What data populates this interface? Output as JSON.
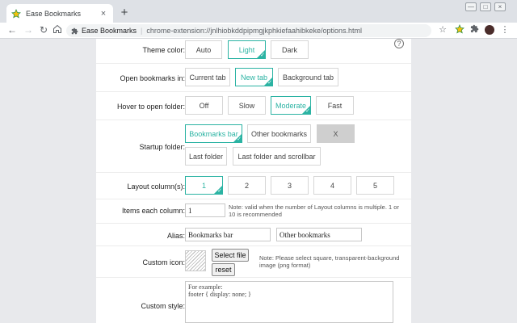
{
  "browser": {
    "tab_title": "Ease Bookmarks",
    "tab_close": "×",
    "new_tab": "+",
    "window_controls": [
      "—",
      "□",
      "×"
    ],
    "address_ext_name": "Ease Bookmarks",
    "address_separator": "|",
    "address_url": "chrome-extension://jnlhiobkddpipmgjkphkiefaahibkeke/options.html"
  },
  "help": "?",
  "theme": {
    "label": "Theme color:",
    "options": [
      "Auto",
      "Light",
      "Dark"
    ],
    "selected": "Light"
  },
  "open_in": {
    "label": "Open bookmarks in:",
    "options": [
      "Current tab",
      "New tab",
      "Background tab"
    ],
    "selected": "New tab"
  },
  "hover": {
    "label": "Hover to open folder:",
    "options": [
      "Off",
      "Slow",
      "Moderate",
      "Fast"
    ],
    "selected": "Moderate"
  },
  "startup": {
    "label": "Startup folder:",
    "options": [
      "Bookmarks bar",
      "Other bookmarks",
      "X",
      "Last folder",
      "Last folder and scrollbar"
    ],
    "selected": "Bookmarks bar"
  },
  "layout": {
    "label": "Layout column(s):",
    "options": [
      "1",
      "2",
      "3",
      "4",
      "5"
    ],
    "selected": "1"
  },
  "items": {
    "label": "Items each column:",
    "value": "1",
    "note": "Note: valid when the number of Layout columns is multiple. 1 or 10 is recommended"
  },
  "alias": {
    "label": "Alias:",
    "bookmarks_bar": "Bookmarks bar",
    "other_bookmarks": "Other bookmarks"
  },
  "custom_icon": {
    "label": "Custom icon:",
    "select_label": "Select file",
    "reset_label": "reset",
    "note": "Note: Please select square, transparent-background image (png format)"
  },
  "custom_style": {
    "label": "Custom style:",
    "placeholder": "For example:\nfooter { display: none; }"
  },
  "colors": {
    "accent": "#2bb3a3",
    "border": "#d6d6d6",
    "gray_option": "#cfcfcf"
  }
}
